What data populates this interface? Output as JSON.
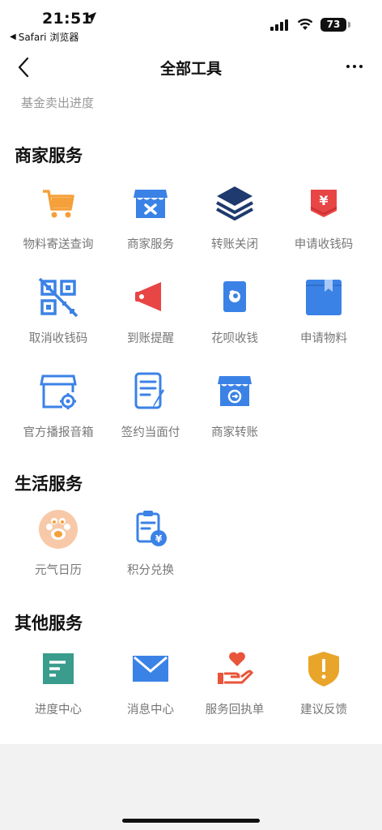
{
  "status_bar": {
    "time": "21:51",
    "back_app_label": "Safari 浏览器",
    "battery": "73"
  },
  "nav": {
    "title": "全部工具"
  },
  "previous_item": "基金卖出进度",
  "sections": {
    "merchant": {
      "title": "商家服务",
      "items": [
        {
          "label": "物料寄送查询",
          "icon": "cart-icon"
        },
        {
          "label": "商家服务",
          "icon": "store-icon"
        },
        {
          "label": "转账关闭",
          "icon": "layers-icon"
        },
        {
          "label": "申请收钱码",
          "icon": "yuan-envelope-icon"
        },
        {
          "label": "取消收钱码",
          "icon": "qr-cancel-icon"
        },
        {
          "label": "到账提醒",
          "icon": "megaphone-icon"
        },
        {
          "label": "花呗收钱",
          "icon": "huabei-icon"
        },
        {
          "label": "申请物料",
          "icon": "box-icon"
        },
        {
          "label": "官方播报音箱",
          "icon": "store-gear-icon"
        },
        {
          "label": "签约当面付",
          "icon": "document-pen-icon"
        },
        {
          "label": "商家转账",
          "icon": "store-transfer-icon"
        }
      ]
    },
    "life": {
      "title": "生活服务",
      "items": [
        {
          "label": "元气日历",
          "icon": "paw-icon"
        },
        {
          "label": "积分兑换",
          "icon": "points-exchange-icon"
        }
      ]
    },
    "other": {
      "title": "其他服务",
      "items": [
        {
          "label": "进度中心",
          "icon": "progress-icon"
        },
        {
          "label": "消息中心",
          "icon": "mail-icon"
        },
        {
          "label": "服务回执单",
          "icon": "heart-hand-icon"
        },
        {
          "label": "建议反馈",
          "icon": "shield-alert-icon"
        }
      ]
    }
  },
  "colors": {
    "blue": "#3b82e6",
    "navy": "#1e3a6e",
    "red": "#e84545",
    "orange": "#f5a03a",
    "teal": "#3a9c8c",
    "gold": "#e8a52a",
    "label": "#777777"
  }
}
